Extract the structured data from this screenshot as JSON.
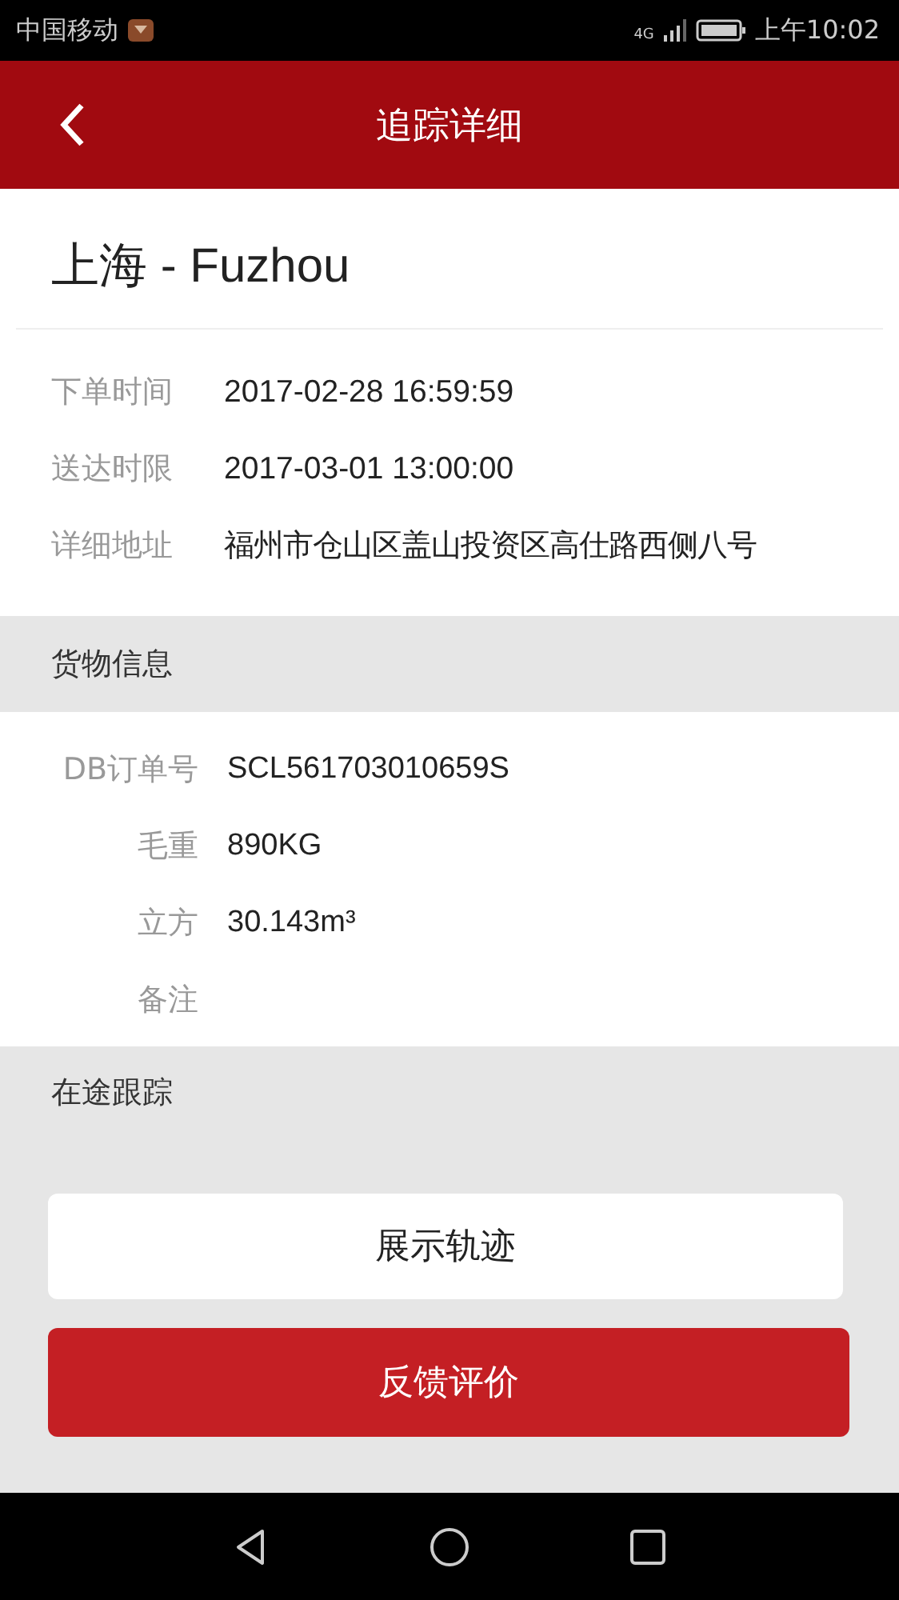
{
  "status_bar": {
    "carrier": "中国移动",
    "network": "4G",
    "time": "上午10:02"
  },
  "header": {
    "title": "追踪详细"
  },
  "route": {
    "title": "上海 - Fuzhou"
  },
  "order_info": [
    {
      "label": "下单时间",
      "value": "2017-02-28 16:59:59"
    },
    {
      "label": "送达时限",
      "value": "2017-03-01 13:00:00"
    },
    {
      "label": "详细地址",
      "value": "福州市仓山区盖山投资区高仕路西侧八号"
    }
  ],
  "cargo_section": {
    "title": "货物信息"
  },
  "cargo_info": [
    {
      "label": "DB订单号",
      "value": "SCL561703010659S"
    },
    {
      "label": "毛重",
      "value": "890KG"
    },
    {
      "label": "立方",
      "value": "30.143m³"
    },
    {
      "label": "备注"
    }
  ],
  "tracking_section": {
    "title": "在途跟踪"
  },
  "buttons": [
    {
      "kind": "secondary",
      "label": "展示轨迹"
    },
    {
      "kind": "primary",
      "label": "反馈评价"
    }
  ]
}
